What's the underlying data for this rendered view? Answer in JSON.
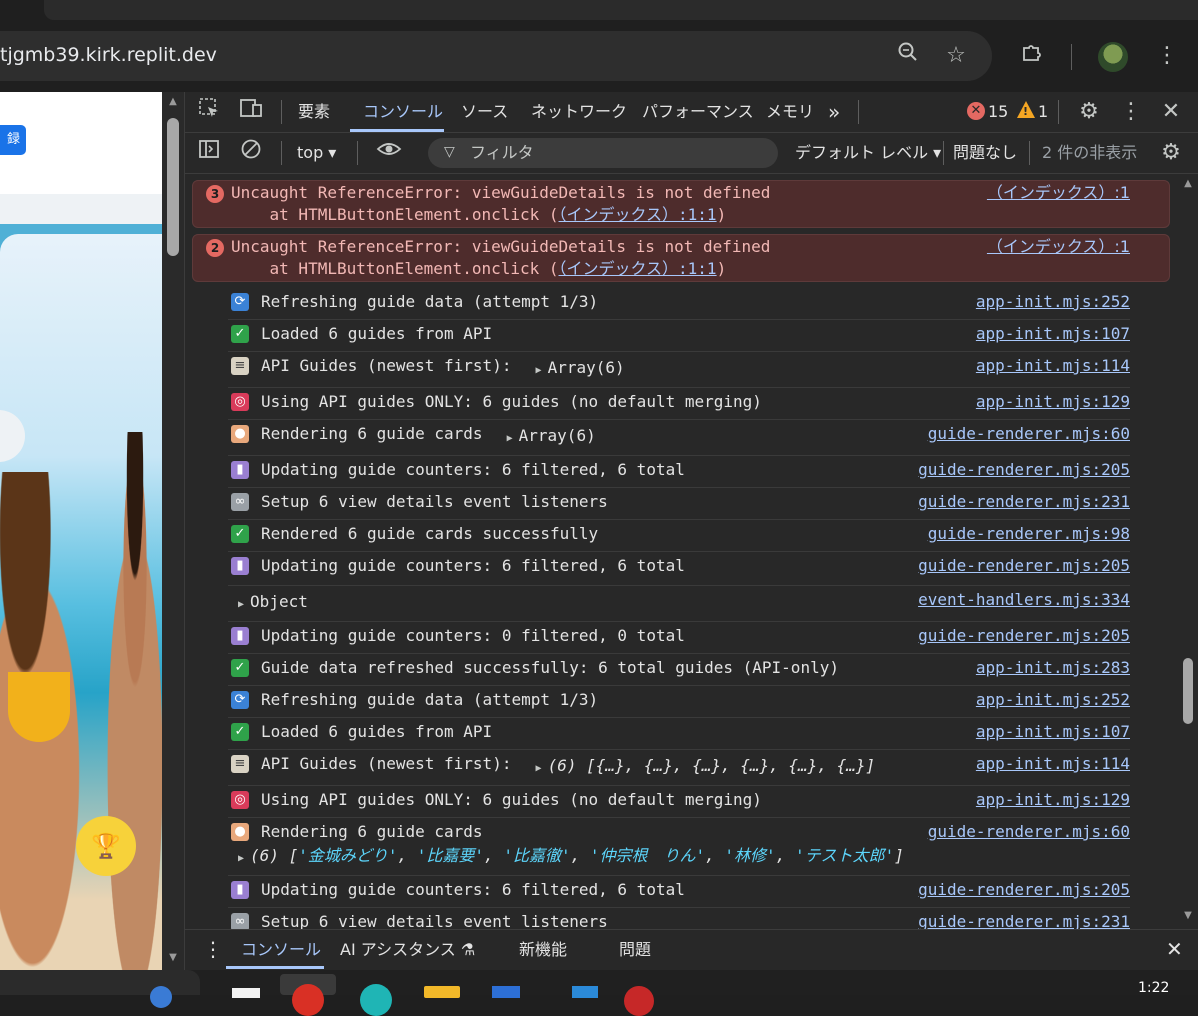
{
  "browser": {
    "url": "tjgmb39.kirk.replit.dev",
    "zoom_icon": "zoom-icon",
    "bookmark_icon": "star-icon",
    "extensions_icon": "puzzle-icon",
    "menu_icon": "kebab-menu-icon"
  },
  "page": {
    "register_button_label": "録",
    "trophy_icon": "trophy-icon"
  },
  "devtools": {
    "tabs": [
      "要素",
      "コンソール",
      "ソース",
      "ネットワーク",
      "パフォーマンス",
      "メモリ"
    ],
    "more_tabs": "»",
    "error_count": "15",
    "warning_count": "1",
    "filterbar": {
      "context": "top ▾",
      "filter_placeholder": "フィルタ",
      "level": "デフォルト レベル ▾",
      "issues": "問題なし",
      "hidden": "2 件の非表示"
    },
    "errors": [
      {
        "count": "3",
        "line1": "Uncaught ReferenceError: viewGuideDetails is not defined",
        "line2a": "    at HTMLButtonElement.onclick (",
        "line2b": "（インデックス）:1:1",
        "line2c": ")",
        "source": "（インデックス）:1"
      },
      {
        "count": "2",
        "line1": "Uncaught ReferenceError: viewGuideDetails is not defined",
        "line2a": "    at HTMLButtonElement.onclick (",
        "line2b": "（インデックス）:1:1",
        "line2c": ")",
        "source": "（インデックス）:1"
      }
    ],
    "messages": [
      {
        "icon": "refresh",
        "text": "Refreshing guide data (attempt 1/3)",
        "extra": "",
        "source": "app-init.mjs:252"
      },
      {
        "icon": "check",
        "text": "Loaded 6 guides from API",
        "extra": "",
        "source": "app-init.mjs:107"
      },
      {
        "icon": "clipboard",
        "text": "API Guides (newest first): ",
        "extra": "Array(6)",
        "source": "app-init.mjs:114"
      },
      {
        "icon": "target",
        "text": "Using API guides ONLY: 6 guides (no default merging)",
        "extra": "",
        "source": "app-init.mjs:129"
      },
      {
        "icon": "palette",
        "text": "Rendering 6 guide cards ",
        "extra": "Array(6)",
        "source": "guide-renderer.mjs:60"
      },
      {
        "icon": "chart",
        "text": "Updating guide counters: 6 filtered, 6 total",
        "extra": "",
        "source": "guide-renderer.mjs:205"
      },
      {
        "icon": "link",
        "text": "Setup 6 view details event listeners",
        "extra": "",
        "source": "guide-renderer.mjs:231"
      },
      {
        "icon": "check",
        "text": "Rendered 6 guide cards successfully",
        "extra": "",
        "source": "guide-renderer.mjs:98"
      },
      {
        "icon": "chart",
        "text": "Updating guide counters: 6 filtered, 6 total",
        "extra": "",
        "source": "guide-renderer.mjs:205"
      },
      {
        "icon": "",
        "text": "",
        "extra": "Object",
        "source": "event-handlers.mjs:334"
      },
      {
        "icon": "chart",
        "text": "Updating guide counters: 0 filtered, 0 total",
        "extra": "",
        "source": "guide-renderer.mjs:205"
      },
      {
        "icon": "check",
        "text": "Guide data refreshed successfully: 6 total guides (API-only)",
        "extra": "",
        "source": "app-init.mjs:283"
      },
      {
        "icon": "refresh",
        "text": "Refreshing guide data (attempt 1/3)",
        "extra": "",
        "source": "app-init.mjs:252"
      },
      {
        "icon": "check",
        "text": "Loaded 6 guides from API",
        "extra": "",
        "source": "app-init.mjs:107"
      },
      {
        "icon": "clipboard",
        "text": "API Guides (newest first): ",
        "extra": "(6) [{…}, {…}, {…}, {…}, {…}, {…}]",
        "source": "app-init.mjs:114"
      },
      {
        "icon": "target",
        "text": "Using API guides ONLY: 6 guides (no default merging)",
        "extra": "",
        "source": "app-init.mjs:129"
      },
      {
        "icon": "palette",
        "text": "Rendering 6 guide cards",
        "extra": "",
        "source": "guide-renderer.mjs:60"
      },
      {
        "icon": "chart",
        "text": "Updating guide counters: 6 filtered, 6 total",
        "extra": "",
        "source": "guide-renderer.mjs:205"
      },
      {
        "icon": "link",
        "text": "Setup 6 view details event listeners",
        "extra": "",
        "source": "guide-renderer.mjs:231"
      }
    ],
    "array_prefix": "(6) [",
    "array_items": [
      "'金城みどり'",
      "'比嘉要'",
      "'比嘉徹'",
      "'仲宗根　りん'",
      "'林修'",
      "'テスト太郎'"
    ],
    "array_suffix": "]",
    "drawer_tabs": [
      "コンソール",
      "AI アシスタンス ⚗",
      "新機能",
      "問題"
    ]
  },
  "taskbar": {
    "clock": "1:22"
  },
  "colors": {
    "link": "#a8c7fa",
    "error_bg": "#4e2c2c",
    "error_text": "#f2b8b5",
    "accent": "#a8c7fa"
  }
}
